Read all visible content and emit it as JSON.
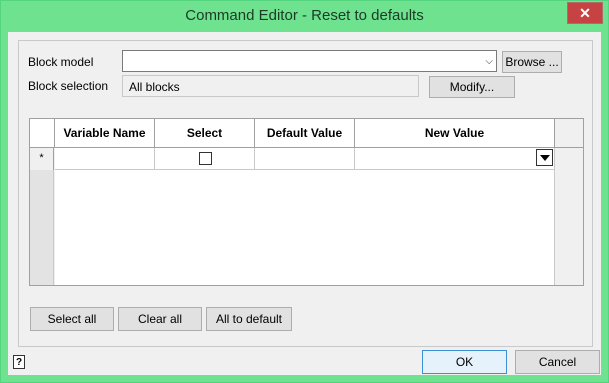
{
  "window": {
    "title": "Command Editor - Reset to defaults",
    "close_label": "✕"
  },
  "block_model": {
    "label": "Block model",
    "value": "",
    "browse_label": "Browse ..."
  },
  "block_selection": {
    "label": "Block selection",
    "value": "All blocks",
    "modify_label": "Modify..."
  },
  "table": {
    "columns": [
      "Variable Name",
      "Select",
      "Default Value",
      "New Value"
    ],
    "new_row_marker": "*",
    "rows": [
      {
        "variable_name": "",
        "select": false,
        "default_value": "",
        "new_value": ""
      }
    ]
  },
  "actions": {
    "select_all": "Select all",
    "clear_all": "Clear all",
    "all_to_default": "All to default"
  },
  "footer": {
    "help_label": "?",
    "ok_label": "OK",
    "cancel_label": "Cancel"
  }
}
